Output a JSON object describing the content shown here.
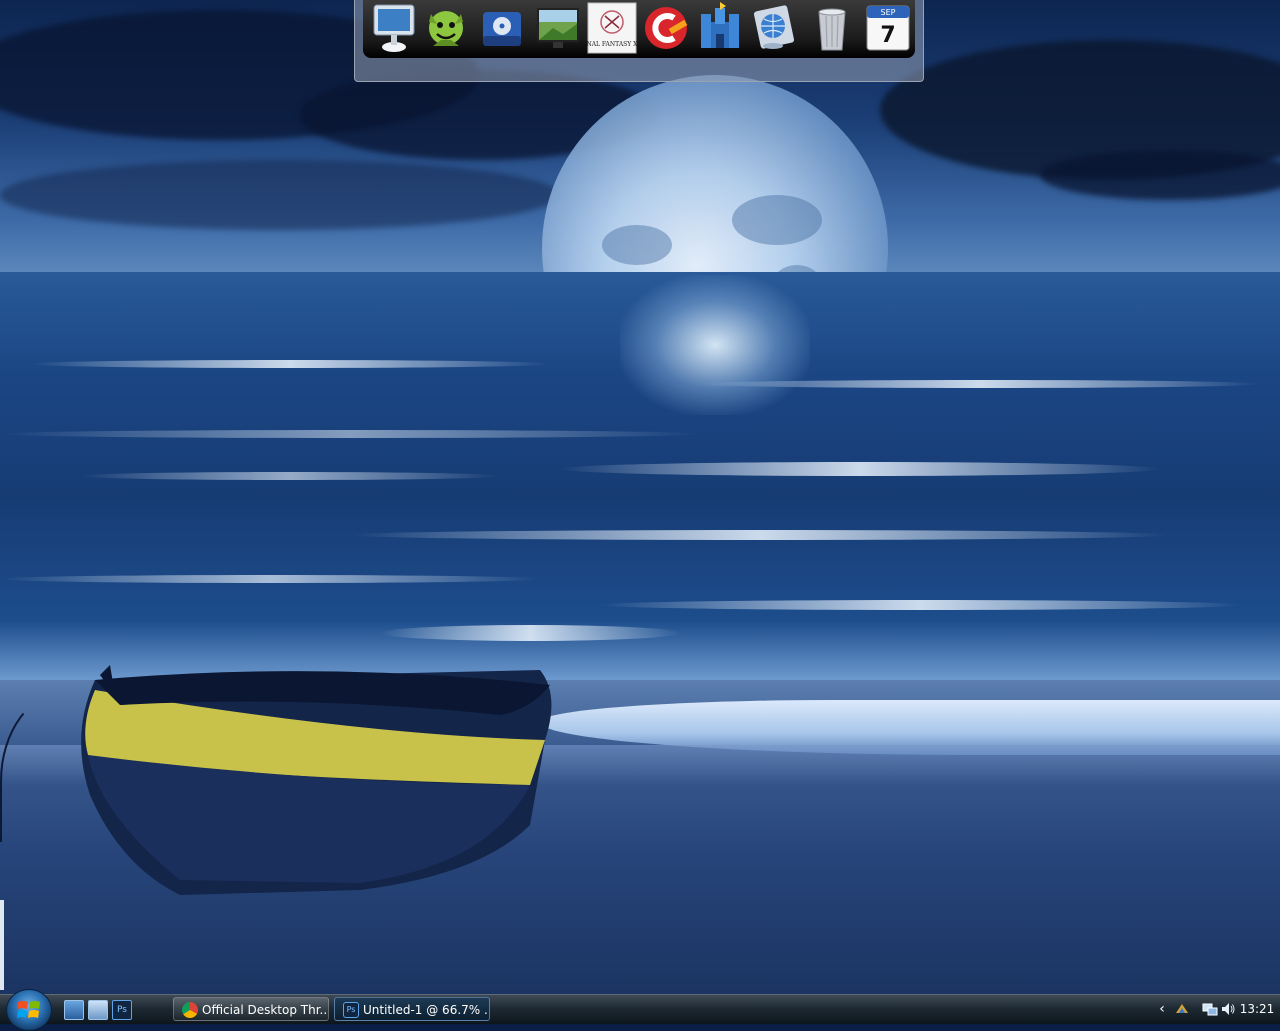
{
  "dock": {
    "items": [
      {
        "name": "computer",
        "icon": "imac-icon"
      },
      {
        "name": "torrent-client",
        "icon": "green-demon-icon"
      },
      {
        "name": "disc-drive",
        "icon": "dvd-drive-icon"
      },
      {
        "name": "desktop-wallpaper",
        "icon": "monitor-landscape-icon"
      },
      {
        "name": "final-fantasy-xiv",
        "icon": "final-fantasy-xiv-icon"
      },
      {
        "name": "ccleaner",
        "icon": "ccleaner-icon"
      },
      {
        "name": "castle",
        "icon": "castle-icon"
      },
      {
        "name": "network",
        "icon": "network-globe-icon"
      },
      {
        "name": "trash",
        "icon": "trash-can-icon"
      },
      {
        "name": "calendar",
        "icon": "calendar-icon",
        "month": "SEP",
        "day": "7"
      }
    ]
  },
  "taskbar": {
    "start_icon": "windows-logo-icon",
    "quick_launch": [
      {
        "name": "show-desktop",
        "icon": "desktop-icon"
      },
      {
        "name": "switch-windows",
        "icon": "window-switcher-icon"
      },
      {
        "name": "photoshop",
        "icon": "photoshop-icon",
        "label": "Ps"
      }
    ],
    "tasks": [
      {
        "label": "Official Desktop Thr...",
        "icon": "chrome-icon"
      },
      {
        "label": "Untitled-1 @ 66.7% ...",
        "icon": "photoshop-icon",
        "icon_label": "Ps"
      }
    ],
    "tray": {
      "chevron": "‹",
      "time": "13:21"
    }
  },
  "colors": {
    "taskbar": "#1e2a33",
    "active_task_border": "#8cbef0",
    "wallpaper_sea": "#173c74"
  }
}
